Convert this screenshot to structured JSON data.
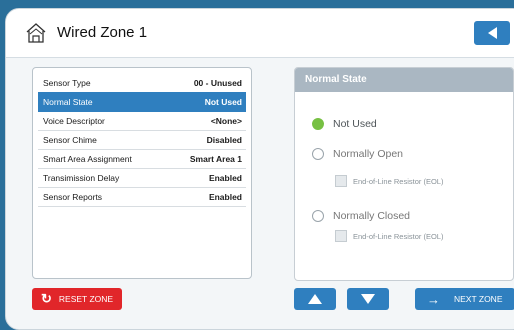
{
  "header": {
    "title": "Wired Zone 1",
    "home_icon": "house-icon",
    "back_icon": "back-arrow-icon"
  },
  "settings": [
    {
      "label": "Sensor Type",
      "value": "00 - Unused"
    },
    {
      "label": "Normal State",
      "value": "Not Used",
      "selected": true
    },
    {
      "label": "Voice Descriptor",
      "value": "<None>"
    },
    {
      "label": "Sensor Chime",
      "value": "Disabled"
    },
    {
      "label": "Smart Area Assignment",
      "value": "Smart Area 1"
    },
    {
      "label": "Transimission Delay",
      "value": "Enabled"
    },
    {
      "label": "Sensor Reports",
      "value": "Enabled"
    }
  ],
  "normal_state": {
    "heading": "Normal State",
    "options": [
      {
        "label": "Not Used",
        "checked": true
      },
      {
        "label": "Normally Open",
        "checked": false
      },
      {
        "label": "Normally Closed",
        "checked": false
      }
    ],
    "eol_label": "End-of-Line Resistor (EOL)"
  },
  "footer": {
    "reset_label": "RESET ZONE",
    "next_label": "NEXT ZONE"
  },
  "colors": {
    "accent": "#2f7fbf",
    "danger": "#e1262a",
    "selected_radio": "#77c043",
    "panel_header": "#aab7c2"
  }
}
